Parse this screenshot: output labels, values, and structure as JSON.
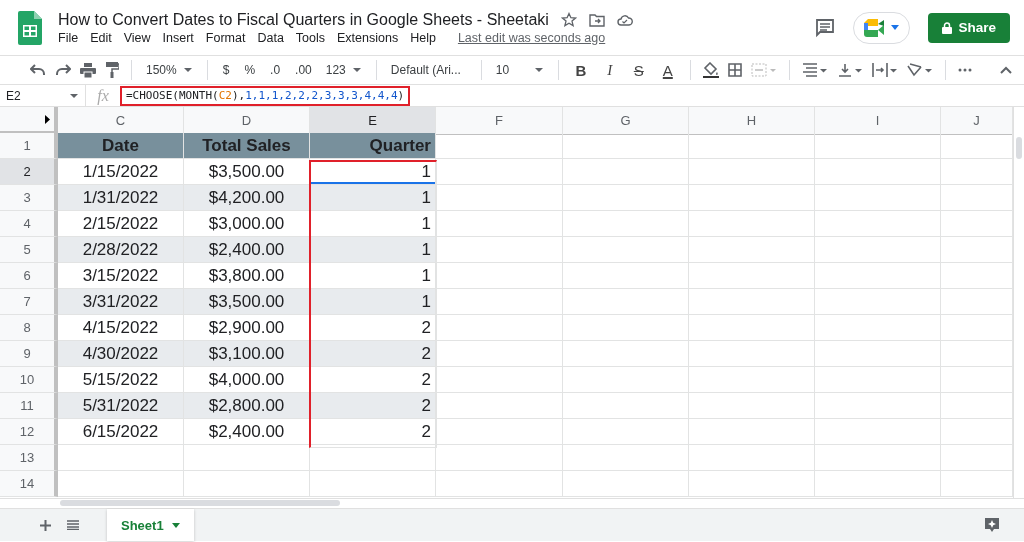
{
  "header": {
    "title": "How to Convert Dates to Fiscal Quarters in Google Sheets - Sheetaki",
    "menus": [
      "File",
      "Edit",
      "View",
      "Insert",
      "Format",
      "Data",
      "Tools",
      "Extensions",
      "Help"
    ],
    "last_edit": "Last edit was seconds ago",
    "share_label": "Share"
  },
  "toolbar": {
    "zoom": "150%",
    "format_buttons": [
      "$",
      "%",
      ".0",
      ".00",
      "123"
    ],
    "font": "Default (Ari...",
    "font_size": "10",
    "text_style_buttons": [
      "B",
      "I",
      "S",
      "A"
    ]
  },
  "formula_bar": {
    "cell_name": "E2",
    "fx_label": "fx",
    "highlighted": true,
    "tokens": [
      {
        "kind": "plain",
        "text": "=CHOOSE(MONTH("
      },
      {
        "kind": "ref",
        "text": "C2"
      },
      {
        "kind": "plain",
        "text": "),"
      },
      {
        "kind": "number",
        "text": "1,1,1,2,2,2,3,3,3,4,4,4"
      },
      {
        "kind": "plain",
        "text": ")"
      }
    ]
  },
  "grid": {
    "columns": [
      {
        "label": "C",
        "selected": false,
        "highlighted": false
      },
      {
        "label": "D",
        "selected": false,
        "highlighted": false
      },
      {
        "label": "E",
        "selected": true,
        "highlighted": true
      },
      {
        "label": "F",
        "selected": false,
        "highlighted": false
      },
      {
        "label": "G",
        "selected": false,
        "highlighted": false
      },
      {
        "label": "H",
        "selected": false,
        "highlighted": false
      },
      {
        "label": "I",
        "selected": false,
        "highlighted": false
      },
      {
        "label": "J",
        "selected": false,
        "highlighted": false
      }
    ],
    "rows": [
      {
        "number": "1",
        "kind": "header",
        "cells": [
          "Date",
          "Total Sales",
          "Quarter"
        ],
        "selected": false
      },
      {
        "number": "2",
        "kind": "data",
        "cells": [
          "1/15/2022",
          "$3,500.00",
          "1"
        ],
        "shaded": false,
        "selected": true
      },
      {
        "number": "3",
        "kind": "data",
        "cells": [
          "1/31/2022",
          "$4,200.00",
          "1"
        ],
        "shaded": true,
        "selected": false
      },
      {
        "number": "4",
        "kind": "data",
        "cells": [
          "2/15/2022",
          "$3,000.00",
          "1"
        ],
        "shaded": false,
        "selected": false
      },
      {
        "number": "5",
        "kind": "data",
        "cells": [
          "2/28/2022",
          "$2,400.00",
          "1"
        ],
        "shaded": true,
        "selected": false
      },
      {
        "number": "6",
        "kind": "data",
        "cells": [
          "3/15/2022",
          "$3,800.00",
          "1"
        ],
        "shaded": false,
        "selected": false
      },
      {
        "number": "7",
        "kind": "data",
        "cells": [
          "3/31/2022",
          "$3,500.00",
          "1"
        ],
        "shaded": true,
        "selected": false
      },
      {
        "number": "8",
        "kind": "data",
        "cells": [
          "4/15/2022",
          "$2,900.00",
          "2"
        ],
        "shaded": false,
        "selected": false
      },
      {
        "number": "9",
        "kind": "data",
        "cells": [
          "4/30/2022",
          "$3,100.00",
          "2"
        ],
        "shaded": true,
        "selected": false
      },
      {
        "number": "10",
        "kind": "data",
        "cells": [
          "5/15/2022",
          "$4,000.00",
          "2"
        ],
        "shaded": false,
        "selected": false
      },
      {
        "number": "11",
        "kind": "data",
        "cells": [
          "5/31/2022",
          "$2,800.00",
          "2"
        ],
        "shaded": true,
        "selected": false
      },
      {
        "number": "12",
        "kind": "data",
        "cells": [
          "6/15/2022",
          "$2,400.00",
          "2"
        ],
        "shaded": false,
        "selected": false
      },
      {
        "number": "13",
        "kind": "empty",
        "cells": [],
        "selected": false
      },
      {
        "number": "14",
        "kind": "empty",
        "cells": [],
        "selected": false
      }
    ]
  },
  "sheet_tabs": [
    {
      "label": "Sheet1",
      "selected": true
    }
  ]
}
